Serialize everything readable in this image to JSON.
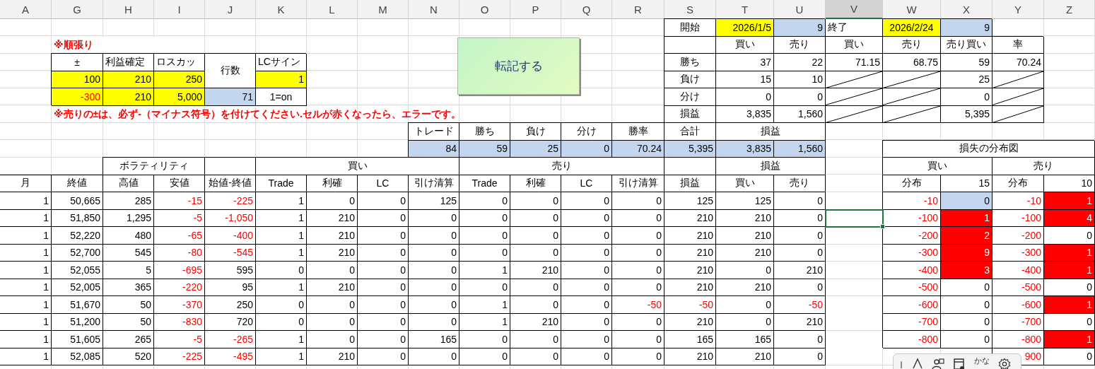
{
  "columns": [
    {
      "label": "A",
      "selected": false
    },
    {
      "label": "G",
      "selected": false
    },
    {
      "label": "H",
      "selected": false
    },
    {
      "label": "I",
      "selected": false
    },
    {
      "label": "J",
      "selected": false
    },
    {
      "label": "K",
      "selected": false
    },
    {
      "label": "L",
      "selected": false
    },
    {
      "label": "M",
      "selected": false
    },
    {
      "label": "N",
      "selected": false
    },
    {
      "label": "O",
      "selected": false
    },
    {
      "label": "P",
      "selected": false
    },
    {
      "label": "Q",
      "selected": false
    },
    {
      "label": "R",
      "selected": false
    },
    {
      "label": "S",
      "selected": false
    },
    {
      "label": "T",
      "selected": false
    },
    {
      "label": "U",
      "selected": false
    },
    {
      "label": "V",
      "selected": true
    },
    {
      "label": "W",
      "selected": false
    },
    {
      "label": "X",
      "selected": false
    },
    {
      "label": "Y",
      "selected": false
    },
    {
      "label": "Z",
      "selected": false
    }
  ],
  "period": {
    "start_label": "開始",
    "start_date": "2026/1/5",
    "start_count": "9",
    "end_label": "終了",
    "end_date": "2026/2/24",
    "end_count": "9"
  },
  "strategy_label": "※順張り",
  "settings": {
    "headers": [
      "±",
      "利益確定",
      "ロスカッ"
    ],
    "rows": [
      [
        "100",
        "210",
        "250"
      ],
      [
        "-300",
        "210",
        "5,000"
      ]
    ],
    "row_count_label": "行数",
    "row_count": "71",
    "lc_sign_label": "LCサイン",
    "lc_sign": "1",
    "lc_note": "1=on"
  },
  "warning": "※売りの±は、必ず-（マイナス符号）を付けてください.セルが赤くなったら、エラーです。",
  "transfer_button": "転記する",
  "summary": {
    "columns": [
      "買い",
      "売り",
      "買い",
      "売り",
      "売り買い",
      "率"
    ],
    "rows": [
      {
        "label": "勝ち",
        "values": [
          "37",
          "22",
          "71.15",
          "68.75",
          "59",
          "70.24"
        ]
      },
      {
        "label": "負け",
        "values": [
          "15",
          "10",
          {
            "kind": "slash"
          },
          {
            "kind": "slash"
          },
          "25",
          {
            "kind": "slash"
          }
        ]
      },
      {
        "label": "分け",
        "values": [
          "0",
          "0",
          {
            "kind": "slash"
          },
          {
            "kind": "slash"
          },
          "0",
          {
            "kind": "slash"
          }
        ]
      },
      {
        "label": "損益",
        "values": [
          "3,835",
          "1,560",
          {
            "kind": "slash"
          },
          {
            "kind": "slash"
          },
          "5,395",
          {
            "kind": "slash"
          }
        ]
      }
    ]
  },
  "totals": {
    "headers": [
      "トレード",
      "勝ち",
      "負け",
      "分け",
      "勝率",
      "合計"
    ],
    "values": [
      "84",
      "59",
      "25",
      "0",
      "70.24",
      "5,395"
    ],
    "pl_header": "損益",
    "pl_values": [
      "3,835",
      "1,560"
    ]
  },
  "table": {
    "groups": [
      "ボラティリティ",
      "買い",
      "売り",
      "損益"
    ],
    "columns": [
      "月",
      "終値",
      "高値",
      "安値",
      "始値-終値",
      "Trade",
      "利確",
      "LC",
      "引け清算",
      "Trade",
      "利確",
      "LC",
      "引け清算",
      "損益",
      "買い",
      "売り"
    ],
    "rows": [
      {
        "selected": false,
        "cells": [
          "1",
          "50,665",
          "285",
          "-15",
          "-225",
          "1",
          "0",
          "0",
          "125",
          "0",
          "0",
          "0",
          "0",
          "125",
          "125",
          "0"
        ]
      },
      {
        "selected": true,
        "cells": [
          "1",
          "51,850",
          "1,295",
          "-5",
          "-1,050",
          "1",
          "210",
          "0",
          "0",
          "0",
          "0",
          "0",
          "0",
          "210",
          "210",
          "0"
        ]
      },
      {
        "selected": false,
        "cells": [
          "1",
          "52,220",
          "480",
          "-65",
          "-400",
          "1",
          "210",
          "0",
          "0",
          "0",
          "0",
          "0",
          "0",
          "210",
          "210",
          "0"
        ]
      },
      {
        "selected": false,
        "cells": [
          "1",
          "52,700",
          "545",
          "-80",
          "-545",
          "1",
          "210",
          "0",
          "0",
          "0",
          "0",
          "0",
          "0",
          "210",
          "210",
          "0"
        ]
      },
      {
        "selected": false,
        "cells": [
          "1",
          "52,055",
          "5",
          "-695",
          "595",
          "0",
          "0",
          "0",
          "0",
          "1",
          "210",
          "0",
          "0",
          "210",
          "0",
          "210"
        ]
      },
      {
        "selected": false,
        "cells": [
          "1",
          "52,005",
          "365",
          "-220",
          "95",
          "1",
          "210",
          "0",
          "0",
          "0",
          "0",
          "0",
          "0",
          "210",
          "210",
          "0"
        ]
      },
      {
        "selected": false,
        "cells": [
          "1",
          "51,670",
          "50",
          "-370",
          "250",
          "0",
          "0",
          "0",
          "0",
          "1",
          "0",
          "0",
          "-50",
          "-50",
          "0",
          "-50"
        ]
      },
      {
        "selected": false,
        "cells": [
          "1",
          "51,200",
          "50",
          "-830",
          "720",
          "0",
          "0",
          "0",
          "0",
          "1",
          "210",
          "0",
          "0",
          "210",
          "0",
          "210"
        ]
      },
      {
        "selected": false,
        "cells": [
          "1",
          "51,605",
          "265",
          "-5",
          "-265",
          "1",
          "0",
          "0",
          "165",
          "0",
          "0",
          "0",
          "0",
          "165",
          "165",
          "0"
        ]
      },
      {
        "selected": false,
        "cells": [
          "1",
          "52,085",
          "520",
          "-225",
          "-495",
          "1",
          "210",
          "0",
          "0",
          "0",
          "0",
          "0",
          "0",
          "210",
          "210",
          "0"
        ]
      }
    ]
  },
  "distribution": {
    "title": "損失の分布図",
    "groups": [
      "買い",
      "売り"
    ],
    "headers": [
      "分布",
      "15",
      "分布",
      "10"
    ],
    "rows": [
      {
        "buy": {
          "bin": "-10",
          "count": "0",
          "color": "#c3d6ee"
        },
        "sell": {
          "bin": "-10",
          "count": "1",
          "color": "#ff0000"
        }
      },
      {
        "buy": {
          "bin": "-100",
          "count": "1",
          "color": "#ff0000"
        },
        "sell": {
          "bin": "-100",
          "count": "4",
          "color": "#ff0000"
        }
      },
      {
        "buy": {
          "bin": "-200",
          "count": "2",
          "color": "#ff0000"
        },
        "sell": {
          "bin": "-200",
          "count": "0"
        }
      },
      {
        "buy": {
          "bin": "-300",
          "count": "9",
          "color": "#ff0000"
        },
        "sell": {
          "bin": "-300",
          "count": "1",
          "color": "#ff0000"
        }
      },
      {
        "buy": {
          "bin": "-400",
          "count": "3",
          "color": "#ff0000"
        },
        "sell": {
          "bin": "-400",
          "count": "1",
          "color": "#ff0000"
        }
      },
      {
        "buy": {
          "bin": "-500",
          "count": "0"
        },
        "sell": {
          "bin": "-500",
          "count": "0"
        }
      },
      {
        "buy": {
          "bin": "-600",
          "count": "0"
        },
        "sell": {
          "bin": "-600",
          "count": "1",
          "color": "#ff0000"
        }
      },
      {
        "buy": {
          "bin": "-700",
          "count": "0"
        },
        "sell": {
          "bin": "-700",
          "count": "0"
        }
      },
      {
        "buy": {
          "bin": "-800",
          "count": "0"
        },
        "sell": {
          "bin": "-800",
          "count": "1",
          "color": "#ff0000"
        }
      },
      {
        "sell": {
          "bin": "900",
          "count": "0"
        }
      }
    ]
  },
  "ime_toolbar": {
    "kana": "かな"
  }
}
